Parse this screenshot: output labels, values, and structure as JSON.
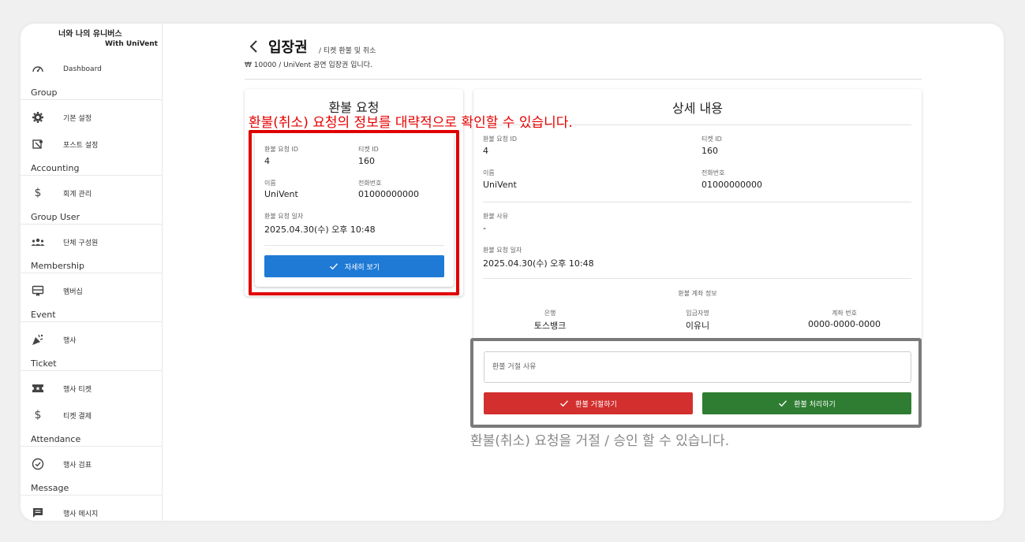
{
  "brand": {
    "line1": "너와 나의 유니버스",
    "line2": "With UniVent"
  },
  "sidebar": {
    "dashboard": "Dashboard",
    "sections": [
      {
        "title": "Group",
        "items": [
          "기본 설정",
          "포스트 설정"
        ]
      },
      {
        "title": "Accounting",
        "items": [
          "회계 관리"
        ]
      },
      {
        "title": "Group User",
        "items": [
          "단체 구성원"
        ]
      },
      {
        "title": "Membership",
        "items": [
          "멤버십"
        ]
      },
      {
        "title": "Event",
        "items": [
          "행사"
        ]
      },
      {
        "title": "Ticket",
        "items": [
          "행사 티켓",
          "티켓 결제"
        ]
      },
      {
        "title": "Attendance",
        "items": [
          "행사 검표"
        ]
      },
      {
        "title": "Message",
        "items": [
          "행사 메시지"
        ]
      }
    ]
  },
  "page": {
    "title": "입장권",
    "subtitle": "/ 티켓 환불 및 취소",
    "description": "₩ 10000 / UniVent 공연 입장권 입니다."
  },
  "refund_card": {
    "heading": "환불 요청",
    "request_id_label": "환불 요청 ID",
    "request_id": "4",
    "ticket_id_label": "티켓 ID",
    "ticket_id": "160",
    "name_label": "이름",
    "name": "UniVent",
    "phone_label": "전화번호",
    "phone": "01000000000",
    "date_label": "환불 요청 일자",
    "date": "2025.04.30(수) 오후 10:48",
    "detail_button": "자세히 보기"
  },
  "detail_card": {
    "heading": "상세 내용",
    "request_id_label": "환불 요청 ID",
    "request_id": "4",
    "ticket_id_label": "티켓 ID",
    "ticket_id": "160",
    "name_label": "이름",
    "name": "UniVent",
    "phone_label": "전화번호",
    "phone": "01000000000",
    "reason_label": "환불 사유",
    "reason": "-",
    "date_label": "환불 요청 일자",
    "date": "2025.04.30(수) 오후 10:48",
    "account_title": "환불 계좌 정보",
    "bank_label": "은행",
    "bank": "토스뱅크",
    "holder_label": "입금자명",
    "holder": "이유니",
    "account_label": "계좌 번호",
    "account": "0000-0000-0000",
    "reject_placeholder": "환불 거절 사유",
    "reject_button": "환불 거절하기",
    "approve_button": "환불 처리하기"
  },
  "annotations": {
    "red": "환불(취소) 요청의 정보를 대략적으로 확인할 수 있습니다.",
    "gray": "환불(취소) 요청을 거절 / 승인 할 수 있습니다."
  },
  "colors": {
    "primary_blue": "#1f7ad6",
    "reject_red": "#d32f2f",
    "approve_green": "#2e7d32",
    "annotation_red": "#e60000"
  }
}
